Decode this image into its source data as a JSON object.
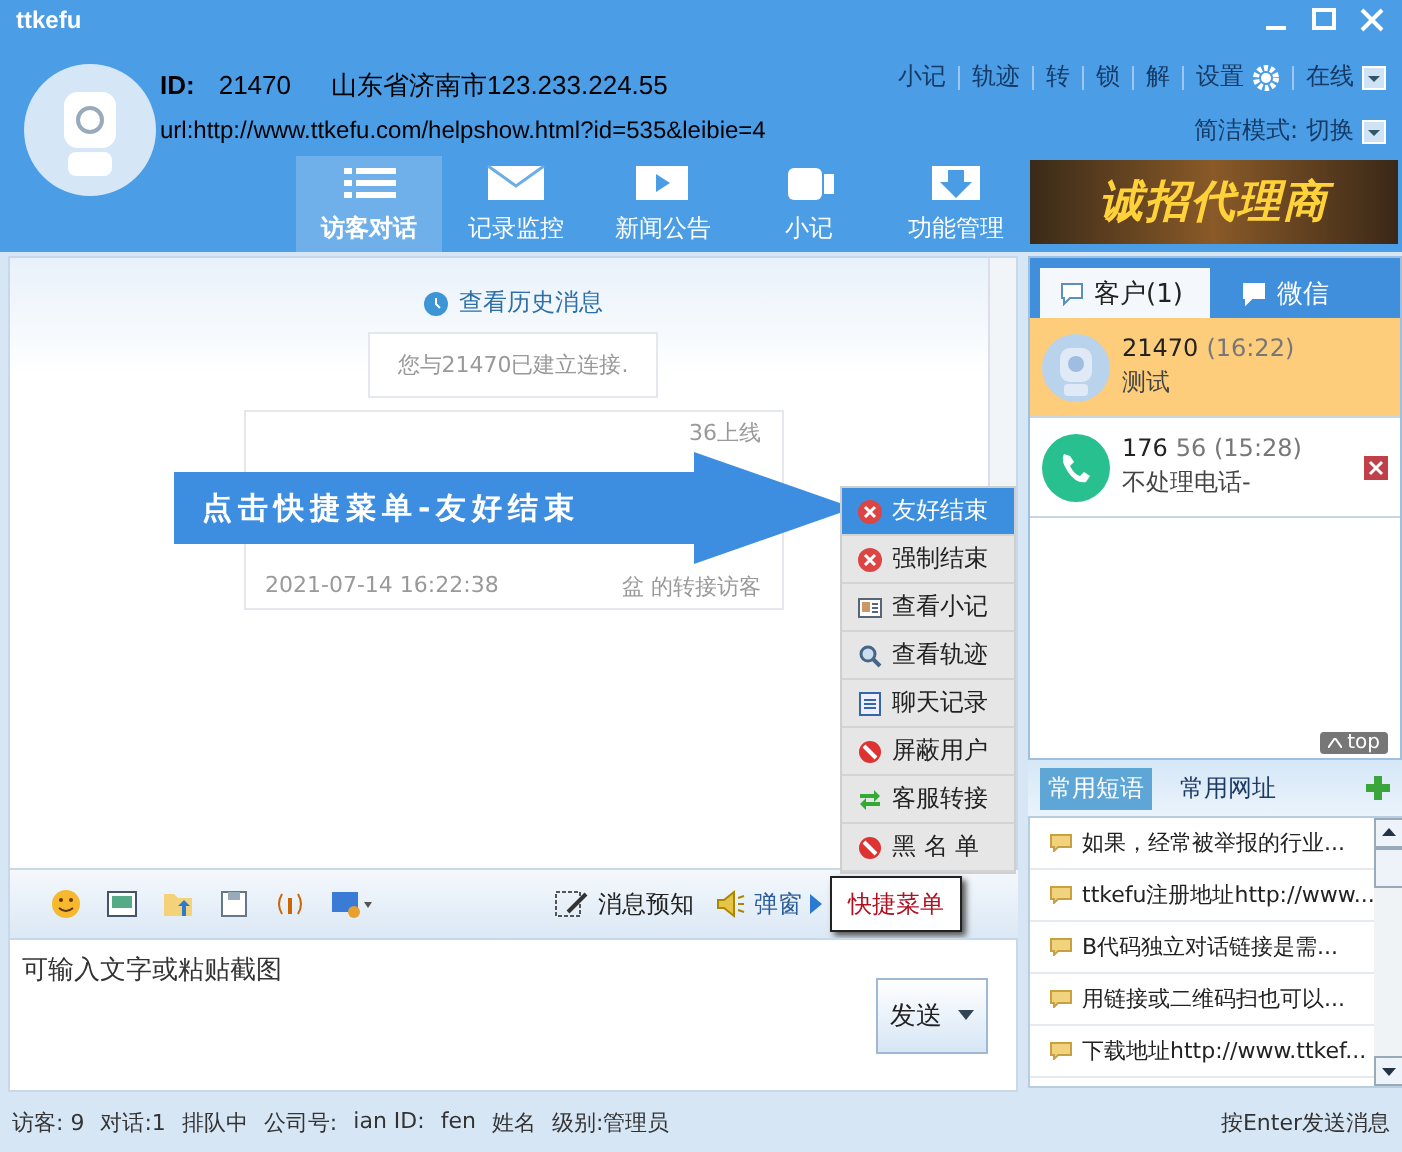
{
  "window": {
    "title": "ttkefu"
  },
  "visitor": {
    "id_label": "ID:",
    "id": "21470",
    "location": "山东省济南市123.233.224.55",
    "url": "url:http://www.ttkefu.com/helpshow.html?id=535&leibie=4"
  },
  "quick_links": [
    "小记",
    "轨迹",
    "转",
    "锁",
    "解"
  ],
  "settings": "设置",
  "status": "在线",
  "mode_label": "简洁模式:",
  "mode_action": "切换",
  "nav": [
    {
      "label": "访客对话",
      "selected": true
    },
    {
      "label": "记录监控",
      "selected": false
    },
    {
      "label": "新闻公告",
      "selected": false
    },
    {
      "label": "小记",
      "selected": false
    },
    {
      "label": "功能管理",
      "selected": false
    }
  ],
  "banner": "诚招代理商",
  "chat": {
    "history_link": "查看历史消息",
    "messages": [
      {
        "kind": "notice",
        "text": "您与21470已建立连接."
      },
      {
        "kind": "transfer",
        "line1": "36上线",
        "line2": "2021-07-14 16:22:38",
        "line3": "盆 的转接访客"
      }
    ]
  },
  "callout": "点击快捷菜单-友好结束",
  "quick_menu": [
    {
      "label": "友好结束",
      "selected": true
    },
    {
      "label": "强制结束",
      "selected": false
    },
    {
      "label": "查看小记",
      "selected": false
    },
    {
      "label": "查看轨迹",
      "selected": false
    },
    {
      "label": "聊天记录",
      "selected": false
    },
    {
      "label": "屏蔽用户",
      "selected": false
    },
    {
      "label": "客服转接",
      "selected": false
    },
    {
      "label": "黑 名 单",
      "selected": false
    }
  ],
  "toolbar": {
    "preview": "消息预知",
    "popup": "弹窗",
    "quick_menu": "快捷菜单"
  },
  "input": {
    "placeholder": "可输入文字或粘贴截图"
  },
  "send": "发送",
  "status_bar": [
    "访客: 9",
    "对话:1",
    "排队中",
    "公司号:",
    "ian ID:",
    "fen",
    "姓名",
    "级别:管理员"
  ],
  "side_tabs": [
    {
      "label": "客户(1)",
      "selected": true
    },
    {
      "label": "微信",
      "selected": false
    }
  ],
  "customers": [
    {
      "kind": "visitor",
      "name": "21470",
      "time": "(16:22)",
      "message": "测试",
      "selected": true
    },
    {
      "kind": "phone",
      "name": "176",
      "time": "56 (15:28)",
      "message": "不处理电话-",
      "selected": false
    }
  ],
  "top_link": "top",
  "phrase_tabs": [
    {
      "label": "常用短语",
      "selected": true
    },
    {
      "label": "常用网址",
      "selected": false
    }
  ],
  "phrases": [
    "如果，经常被举报的行业...",
    "ttkefu注册地址http://www...",
    "B代码独立对话链接是需...",
    "用链接或二维码扫也可以...",
    "下载地址http://www.ttkef..."
  ],
  "enter_hint": "按Enter发送消息"
}
